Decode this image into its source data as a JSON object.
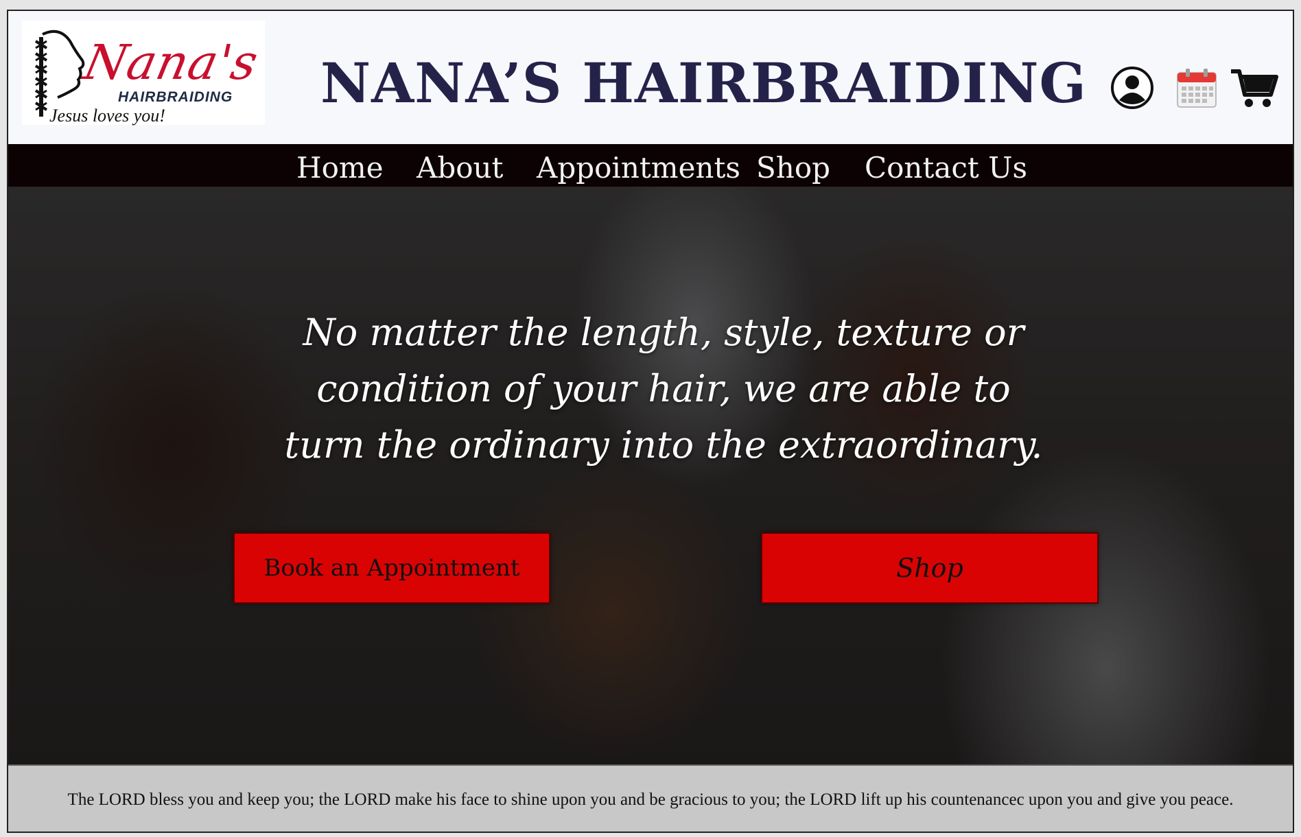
{
  "header": {
    "logo": {
      "script": "Nana's",
      "subtitle": "HAIRBRAIDING",
      "tagline": "Jesus loves you!"
    },
    "title": "NANA’S HAIRBRAIDING",
    "icons": [
      "user-account-icon",
      "calendar-icon",
      "shopping-cart-icon"
    ]
  },
  "nav": {
    "items": [
      {
        "label": "Home"
      },
      {
        "label": "About"
      },
      {
        "label": "Appointments"
      },
      {
        "label": "Shop"
      },
      {
        "label": "Contact Us"
      }
    ]
  },
  "hero": {
    "tagline": "No matter the length, style, texture or condition of your hair, we are able to turn the ordinary into the extraordinary.",
    "buttons": {
      "book": "Book an Appointment",
      "shop": "Shop"
    }
  },
  "footer": {
    "text": "The LORD bless you and keep you; the LORD make his face to shine upon you and be gracious to you; the LORD lift up his countenancec upon you and give you peace."
  },
  "colors": {
    "nav_bg": "#0c0203",
    "title": "#25224a",
    "button_red": "#d90304",
    "logo_red": "#c8102e",
    "footer_bg": "#c8c8c8"
  }
}
